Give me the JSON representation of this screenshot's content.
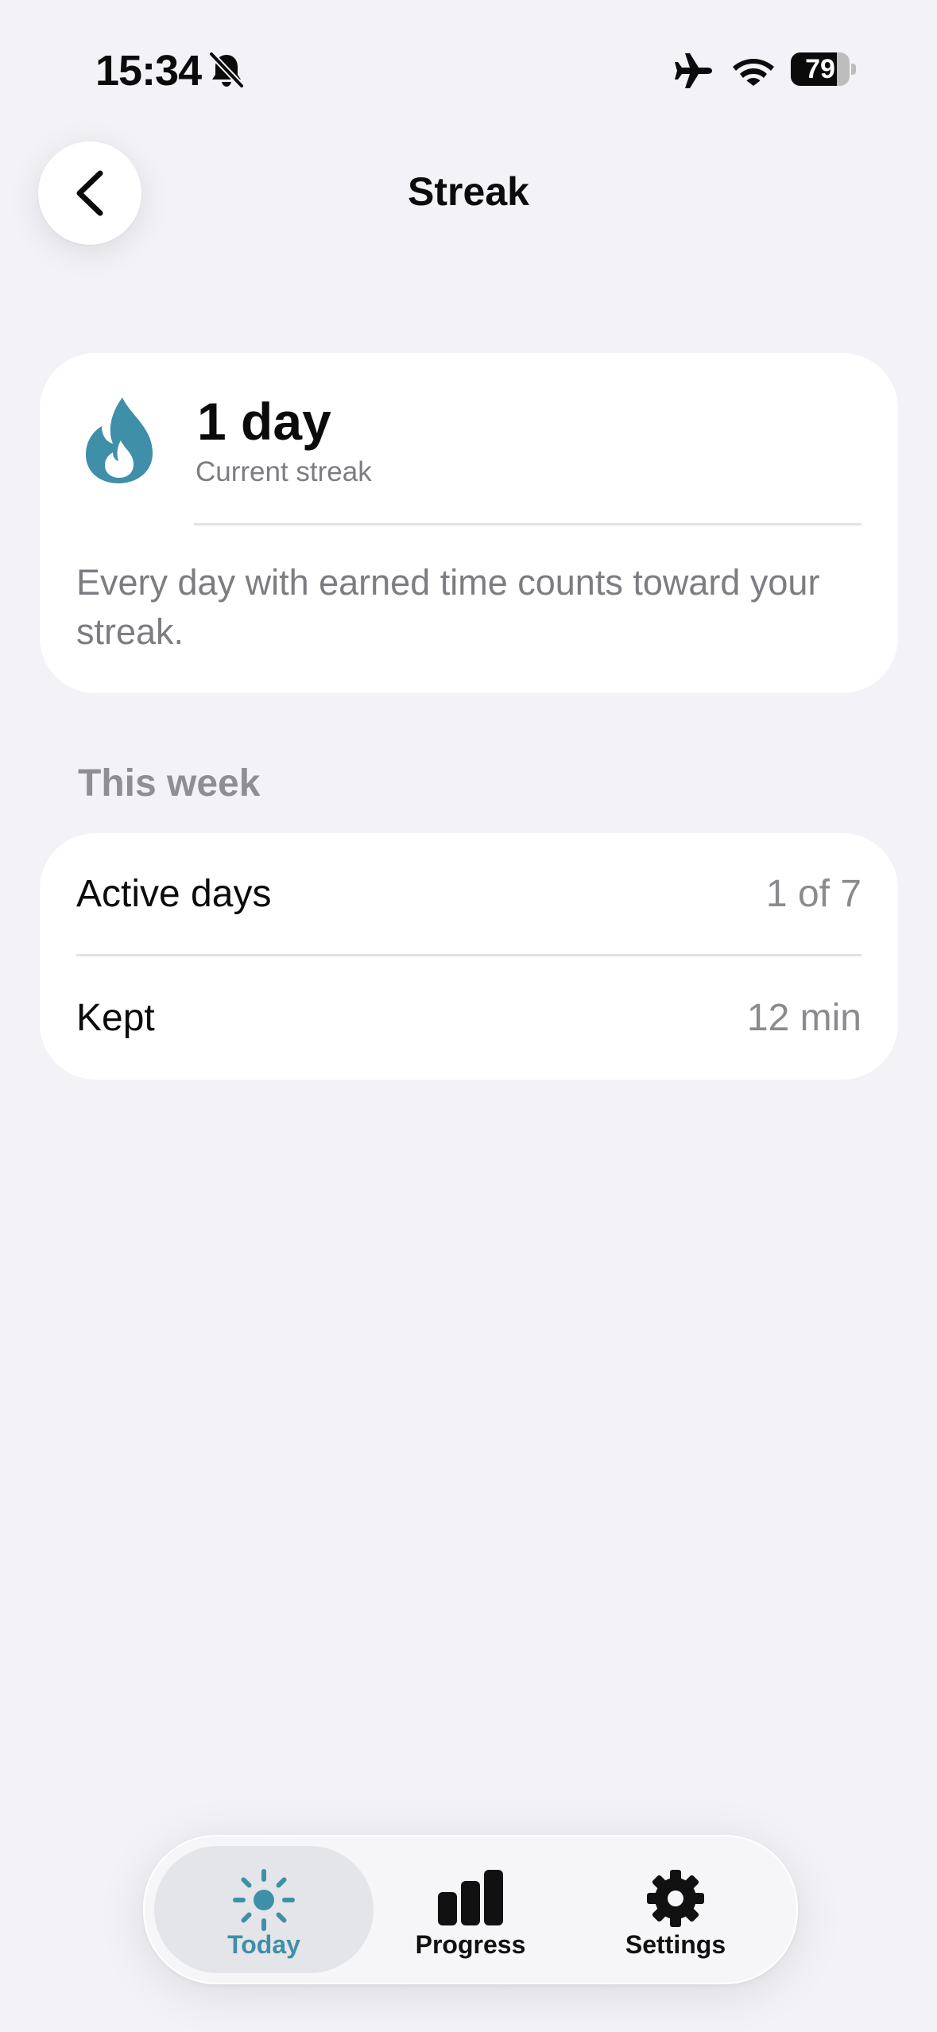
{
  "status_bar": {
    "time": "15:34",
    "battery_level": "79",
    "battery_fraction": 0.79,
    "icons": [
      "bell-slash-icon",
      "airplane-icon",
      "wifi-icon",
      "battery-icon"
    ]
  },
  "nav": {
    "title": "Streak",
    "back_icon": "chevron-left-icon"
  },
  "streak": {
    "value": "1 day",
    "label": "Current streak",
    "description": "Every day with earned time counts toward your streak.",
    "icon": "flame-icon",
    "icon_color": "#3f8fa8"
  },
  "week": {
    "title": "This week",
    "rows": [
      {
        "label": "Active days",
        "value": "1 of 7"
      },
      {
        "label": "Kept",
        "value": "12 min"
      }
    ]
  },
  "tab_bar": {
    "tabs": [
      {
        "label": "Today",
        "icon": "sun-icon",
        "active": true
      },
      {
        "label": "Progress",
        "icon": "bar-chart-icon",
        "active": false
      },
      {
        "label": "Settings",
        "icon": "gear-icon",
        "active": false
      }
    ],
    "active_color": "#3f8fa8",
    "inactive_color": "#111111"
  }
}
